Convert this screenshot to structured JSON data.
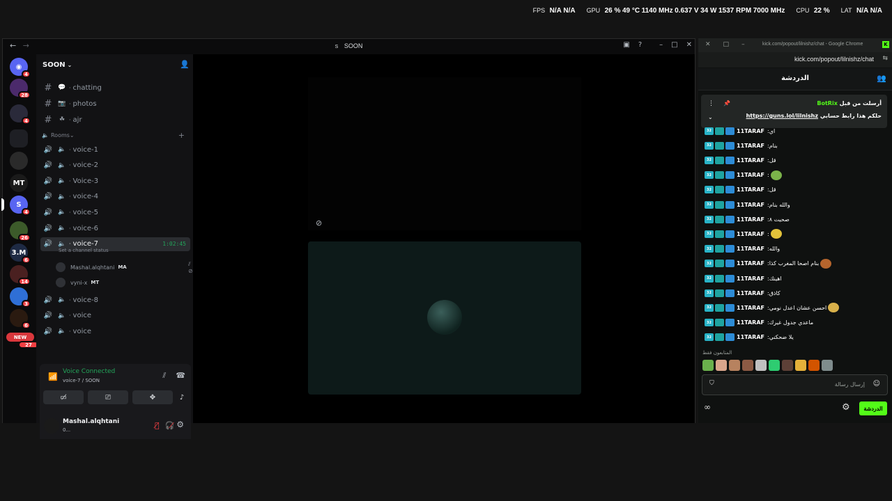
{
  "overlay": {
    "fps_label": "FPS",
    "fps_a": "N/A",
    "fps_b": "N/A",
    "gpu_label": "GPU",
    "gpu_util": "26 %",
    "gpu_temp": "49 °C",
    "gpu_clock": "1140 MHz",
    "gpu_volt": "0.637 V",
    "gpu_power": "34 W",
    "gpu_rpm": "1537 RPM",
    "gpu_mem": "7000 MHz",
    "cpu_label": "CPU",
    "cpu_util": "22 %",
    "lat_label": "LAT",
    "lat_a": "N/A",
    "lat_b": "N/A"
  },
  "discord": {
    "window_title": "SOON",
    "server_icon_text": "S",
    "servers": [
      {
        "name": "discord-home",
        "badge": "4",
        "color": "#5865f2"
      },
      {
        "name": "server-2",
        "badge": "28",
        "color": "#4b2a6b"
      },
      {
        "name": "server-3",
        "badge": "4",
        "color": "#2a2a3a"
      },
      {
        "name": "folder",
        "badge": "",
        "color": "#1e1f24"
      },
      {
        "name": "server-5",
        "badge": "",
        "color": "#2a2a2a"
      },
      {
        "name": "server-6",
        "badge": "",
        "color": "#1a1a1a",
        "text": "MT"
      },
      {
        "name": "server-soon",
        "badge": "4",
        "color": "#5865f2",
        "text": "S"
      },
      {
        "name": "server-8",
        "badge": "26",
        "color": "#3c5a2a"
      },
      {
        "name": "server-9",
        "badge": "6",
        "color": "#1e2a44",
        "text": "3.M"
      },
      {
        "name": "server-10",
        "badge": "14",
        "color": "#4a2020"
      },
      {
        "name": "server-11",
        "badge": "3",
        "color": "#2f6fd6"
      },
      {
        "name": "server-12",
        "badge": "6",
        "color": "#2a1a10"
      }
    ],
    "new_badge": "NEW",
    "new_count": "27",
    "server_name": "SOON",
    "text_channels": [
      {
        "emoji": "💬",
        "name": "chatting"
      },
      {
        "emoji": "📷",
        "name": "photos"
      },
      {
        "emoji": "☘",
        "name": "ajr"
      }
    ],
    "rooms_label": "Rooms",
    "voice_channels": [
      "voice-1",
      "voice-2",
      "Voice-3",
      "voice-4",
      "voice-5",
      "voice-6",
      "voice-7"
    ],
    "active_timer": "1:02:45",
    "channel_status": "Set a channel status",
    "voice_users": [
      {
        "name": "Mashal.alqhtani",
        "tag": "MA"
      },
      {
        "name": "vyni-x",
        "tag": "MT"
      }
    ],
    "voice_channels_after": [
      "voice-8",
      "voice",
      "voice"
    ],
    "voice_connected": "Voice Connected",
    "voice_connected_sub": "voice-7 / SOON",
    "user_name": "Mashal.alqhtani",
    "user_status": "0..."
  },
  "chrome": {
    "window_title": "kick.com/popout/lilnishz/chat - Google Chrome",
    "url": "kick.com/popout/lilnishz/chat",
    "chat_header": "الدردشة",
    "pinned_by": "أرسلت من قبل",
    "pinned_bot": "BotRix",
    "pinned_text": "حلكم هذا رابط حسابي",
    "pinned_link": "https://guns.lol/lilnishz",
    "badge_text": "32",
    "messages": [
      {
        "user": "11TARAF",
        "text": "اي"
      },
      {
        "user": "11TARAF",
        "text": "بنام"
      },
      {
        "user": "11TARAF",
        "text": "قل"
      },
      {
        "user": "11TARAF",
        "text": ""
      },
      {
        "user": "11TARAF",
        "text": "قل"
      },
      {
        "user": "11TARAF",
        "text": "والله بنام"
      },
      {
        "user": "11TARAF",
        "text": "صحيت ٨"
      },
      {
        "user": "11TARAF",
        "text": ""
      },
      {
        "user": "11TARAF",
        "text": "والله"
      },
      {
        "user": "11TARAF",
        "text": "بنام اصحا المغرب كذا"
      },
      {
        "user": "11TARAF",
        "text": "اهينك"
      },
      {
        "user": "11TARAF",
        "text": "كاذق"
      },
      {
        "user": "11TARAF",
        "text": "احسن عشان اعدل نومي"
      },
      {
        "user": "11TARAF",
        "text": "ماعدي جدول غيرك"
      },
      {
        "user": "11TARAF",
        "text": "يلا ضحكني"
      }
    ],
    "subs_only": "المتابعون فقط",
    "input_placeholder": "إرسال رسالة",
    "send_label": "الدردشة"
  }
}
